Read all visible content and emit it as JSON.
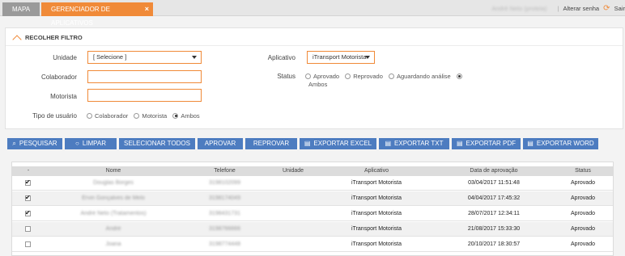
{
  "tabs": [
    {
      "label": "MAPA"
    },
    {
      "label": "GERENCIADOR DE APLICATIVOS",
      "close": "×"
    }
  ],
  "user": {
    "name": "André Neto (proteia)",
    "change_password": "Alterar senha",
    "logout": "Sair"
  },
  "filter": {
    "title": "RECOLHER FILTRO",
    "unidade_label": "Unidade",
    "unidade_value": "[ Selecione ]",
    "colaborador_label": "Colaborador",
    "colaborador_value": "",
    "motorista_label": "Motorista",
    "motorista_value": "",
    "tipo_label": "Tipo de usuário",
    "tipo_options": [
      "Colaborador",
      "Motorista",
      "Ambos"
    ],
    "tipo_selected": "Ambos",
    "aplicativo_label": "Aplicativo",
    "aplicativo_value": "iTransport Motorista",
    "status_label": "Status",
    "status_options": [
      "Aprovado",
      "Reprovado",
      "Aguardando análise",
      "Ambos"
    ],
    "status_selected": "Ambos"
  },
  "buttons": [
    {
      "label": "PESQUISAR",
      "icon": "search-icon"
    },
    {
      "label": "LIMPAR",
      "icon": "circle-icon"
    },
    {
      "label": "SELECIONAR TODOS"
    },
    {
      "label": "APROVAR"
    },
    {
      "label": "REPROVAR"
    },
    {
      "label": "EXPORTAR EXCEL",
      "icon": "export-icon"
    },
    {
      "label": "EXPORTAR TXT",
      "icon": "export-icon"
    },
    {
      "label": "EXPORTAR PDF",
      "icon": "export-icon"
    },
    {
      "label": "EXPORTAR WORD",
      "icon": "export-icon"
    }
  ],
  "table": {
    "columns": [
      "-",
      "Nome",
      "Telefone",
      "Unidade",
      "Aplicativo",
      "Data de aprovação",
      "Status"
    ],
    "rows": [
      {
        "checked": true,
        "nome": "Douglas Borges",
        "telefone": "3198102099",
        "unidade": "",
        "aplicativo": "iTransport Motorista",
        "data": "03/04/2017 11:51:48",
        "status": "Aprovado"
      },
      {
        "checked": true,
        "nome": "Ervin Gonçalves de Melo",
        "telefone": "3198174049",
        "unidade": "",
        "aplicativo": "iTransport Motorista",
        "data": "04/04/2017 17:45:32",
        "status": "Aprovado"
      },
      {
        "checked": true,
        "nome": "André Neto (Tratamentos)",
        "telefone": "3198431731",
        "unidade": "",
        "aplicativo": "iTransport Motorista",
        "data": "28/07/2017 12:34:11",
        "status": "Aprovado"
      },
      {
        "checked": false,
        "nome": "André",
        "telefone": "3198766666",
        "unidade": "",
        "aplicativo": "iTransport Motorista",
        "data": "21/08/2017 15:33:30",
        "status": "Aprovado"
      },
      {
        "checked": false,
        "nome": "Joana",
        "telefone": "3198774448",
        "unidade": "",
        "aplicativo": "iTransport Motorista",
        "data": "20/10/2017 18:30:57",
        "status": "Aprovado"
      }
    ]
  }
}
